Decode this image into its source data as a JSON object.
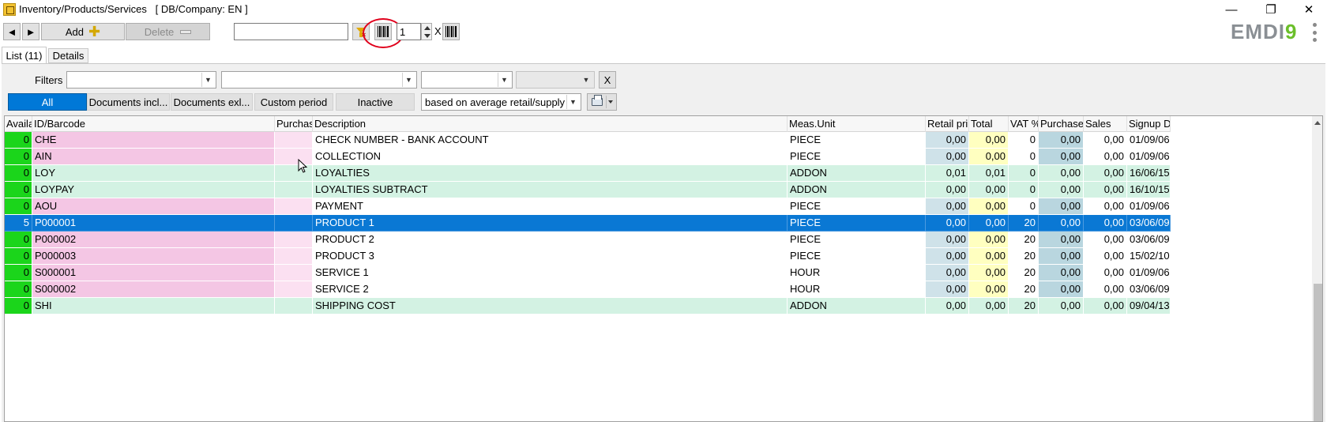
{
  "window": {
    "title": "Inventory/Products/Services   [ DB/Company: EN ]",
    "minimize_glyph": "—",
    "restore_glyph": "❐",
    "close_glyph": "✕"
  },
  "toolbar": {
    "prev_glyph": "◄",
    "next_glyph": "►",
    "add_label": "Add",
    "delete_label": "Delete",
    "search_value": "",
    "quantity_value": "1",
    "times_label": "X",
    "icons": [
      "funnel-icon",
      "barcode-icon",
      "barcode-print-icon"
    ]
  },
  "logo": {
    "text": "EMDI",
    "suffix": "9"
  },
  "tabs": [
    {
      "label": "List (11)",
      "active": true
    },
    {
      "label": "Details",
      "active": false
    }
  ],
  "filters": {
    "label": "Filters",
    "clear_label": "X",
    "combos": [
      "",
      "",
      "",
      ""
    ]
  },
  "segments": [
    {
      "label": "All",
      "active": true
    },
    {
      "label": "Documents incl...",
      "active": false
    },
    {
      "label": "Documents exl...",
      "active": false
    },
    {
      "label": "Custom period",
      "active": false
    },
    {
      "label": "Inactive",
      "active": false
    }
  ],
  "price_basis": "based on average retail/supply p",
  "colors": {
    "selected": "#0a78d4",
    "avail_green": "#1bd51b",
    "id_pink": "#f4c6e4",
    "purchase_pink": "#fbe0f1",
    "addon_green": "#d3f2e3",
    "retail_blue": "#cfe2e9",
    "total_yellow": "#ffffc0",
    "purchase_blue": "#b9d6df"
  },
  "grid": {
    "columns": [
      "Availa",
      "ID/Barcode",
      "Purchas",
      "Description",
      "Meas.Unit",
      "Retail pri",
      "Total",
      "VAT %",
      "Purchase",
      "Sales",
      "Signup D"
    ],
    "rows": [
      {
        "avail": "0",
        "id": "CHE",
        "purchase": "",
        "description": "CHECK NUMBER - BANK ACCOUNT",
        "unit": "PIECE",
        "retail": "0,00",
        "total": "0,00",
        "vat": "0",
        "purchase_price": "0,00",
        "sales": "0,00",
        "signup": "01/09/06",
        "kind": "piece",
        "selected": false
      },
      {
        "avail": "0",
        "id": "AIN",
        "purchase": "",
        "description": "COLLECTION",
        "unit": "PIECE",
        "retail": "0,00",
        "total": "0,00",
        "vat": "0",
        "purchase_price": "0,00",
        "sales": "0,00",
        "signup": "01/09/06",
        "kind": "piece",
        "selected": false
      },
      {
        "avail": "0",
        "id": "LOY",
        "purchase": "",
        "description": "LOYALTIES",
        "unit": "ADDON",
        "retail": "0,01",
        "total": "0,01",
        "vat": "0",
        "purchase_price": "0,00",
        "sales": "0,00",
        "signup": "16/06/15",
        "kind": "addon",
        "selected": false
      },
      {
        "avail": "0",
        "id": "LOYPAY",
        "purchase": "",
        "description": "LOYALTIES SUBTRACT",
        "unit": "ADDON",
        "retail": "0,00",
        "total": "0,00",
        "vat": "0",
        "purchase_price": "0,00",
        "sales": "0,00",
        "signup": "16/10/15",
        "kind": "addon",
        "selected": false
      },
      {
        "avail": "0",
        "id": "AOU",
        "purchase": "",
        "description": "PAYMENT",
        "unit": "PIECE",
        "retail": "0,00",
        "total": "0,00",
        "vat": "0",
        "purchase_price": "0,00",
        "sales": "0,00",
        "signup": "01/09/06",
        "kind": "piece",
        "selected": false
      },
      {
        "avail": "5",
        "id": "P000001",
        "purchase": "",
        "description": "PRODUCT 1",
        "unit": "PIECE",
        "retail": "0,00",
        "total": "0,00",
        "vat": "20",
        "purchase_price": "0,00",
        "sales": "0,00",
        "signup": "03/06/09",
        "kind": "piece",
        "selected": true
      },
      {
        "avail": "0",
        "id": "P000002",
        "purchase": "",
        "description": "PRODUCT 2",
        "unit": "PIECE",
        "retail": "0,00",
        "total": "0,00",
        "vat": "20",
        "purchase_price": "0,00",
        "sales": "0,00",
        "signup": "03/06/09",
        "kind": "piece",
        "selected": false
      },
      {
        "avail": "0",
        "id": "P000003",
        "purchase": "",
        "description": "PRODUCT 3",
        "unit": "PIECE",
        "retail": "0,00",
        "total": "0,00",
        "vat": "20",
        "purchase_price": "0,00",
        "sales": "0,00",
        "signup": "15/02/10",
        "kind": "piece",
        "selected": false
      },
      {
        "avail": "0",
        "id": "S000001",
        "purchase": "",
        "description": "SERVICE 1",
        "unit": "HOUR",
        "retail": "0,00",
        "total": "0,00",
        "vat": "20",
        "purchase_price": "0,00",
        "sales": "0,00",
        "signup": "01/09/06",
        "kind": "piece",
        "selected": false
      },
      {
        "avail": "0",
        "id": "S000002",
        "purchase": "",
        "description": "SERVICE 2",
        "unit": "HOUR",
        "retail": "0,00",
        "total": "0,00",
        "vat": "20",
        "purchase_price": "0,00",
        "sales": "0,00",
        "signup": "03/06/09",
        "kind": "piece",
        "selected": false
      },
      {
        "avail": "0",
        "id": "SHI",
        "purchase": "",
        "description": "SHIPPING COST",
        "unit": "ADDON",
        "retail": "0,00",
        "total": "0,00",
        "vat": "20",
        "purchase_price": "0,00",
        "sales": "0,00",
        "signup": "09/04/13",
        "kind": "addon",
        "selected": false
      }
    ]
  }
}
